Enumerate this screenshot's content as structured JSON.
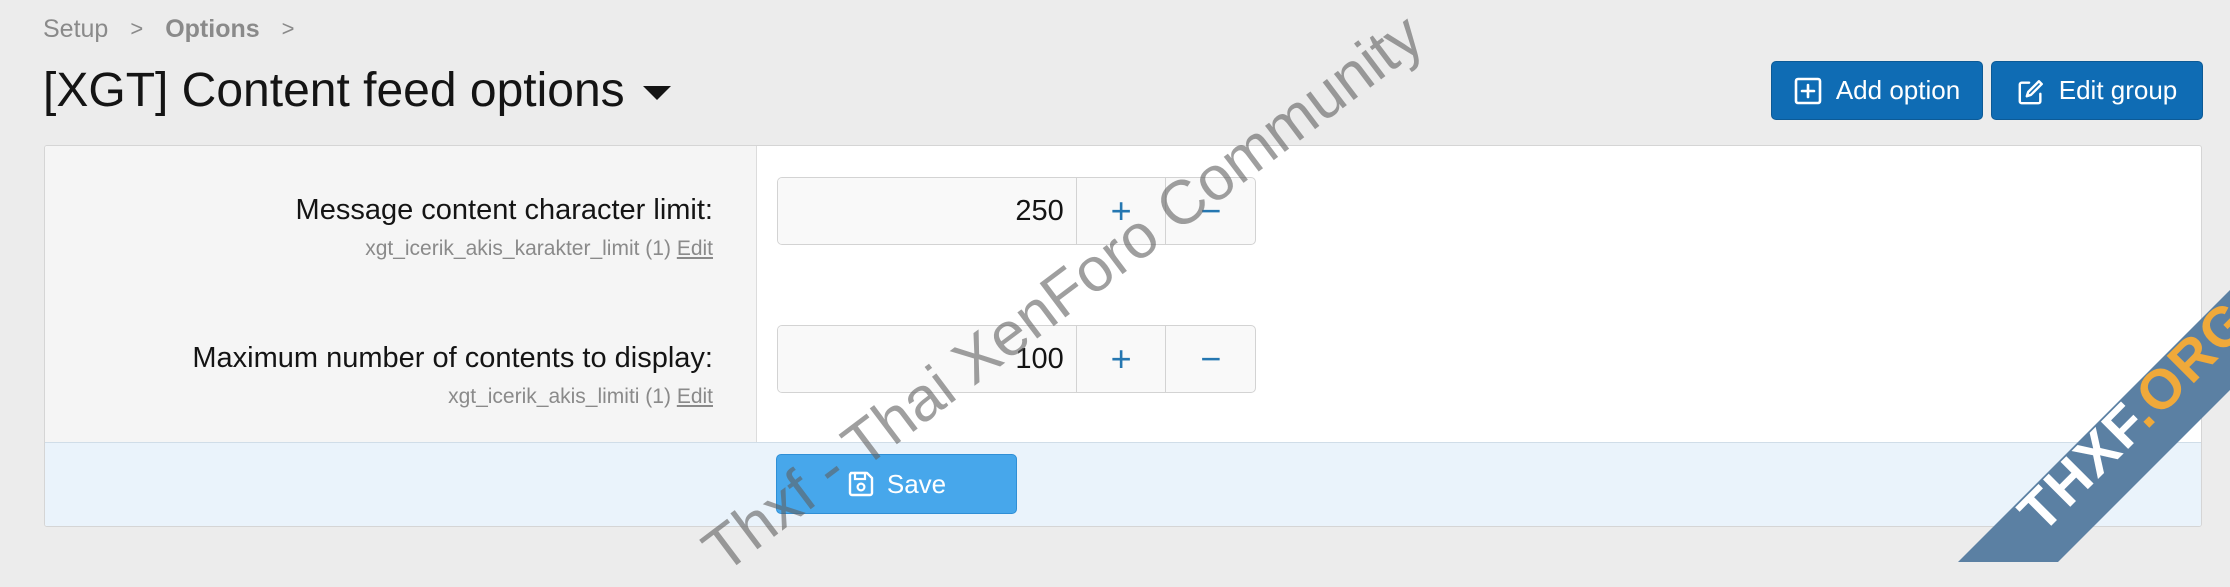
{
  "breadcrumb": {
    "items": [
      "Setup",
      "Options"
    ],
    "separator": ">"
  },
  "page": {
    "title": "[XGT] Content feed options"
  },
  "header_buttons": {
    "add_option": "Add option",
    "edit_group": "Edit group"
  },
  "options": [
    {
      "label": "Message content character limit:",
      "key": "xgt_icerik_akis_karakter_limit (1)",
      "edit": "Edit",
      "value": "250"
    },
    {
      "label": "Maximum number of contents to display:",
      "key": "xgt_icerik_akis_limiti (1)",
      "edit": "Edit",
      "value": "100"
    }
  ],
  "stepper": {
    "plus": "+",
    "minus": "−"
  },
  "footer": {
    "save": "Save"
  },
  "watermark": {
    "text": "Thxf - Thai XenForo Community",
    "corner_text": "THXF",
    "corner_suffix": ".ORG"
  },
  "colors": {
    "primary": "#0f6cb4",
    "save": "#47a7eb",
    "accent": "#2577b1",
    "ribbon": "#5b80a3",
    "ribbon_suffix": "#f0a93a"
  }
}
